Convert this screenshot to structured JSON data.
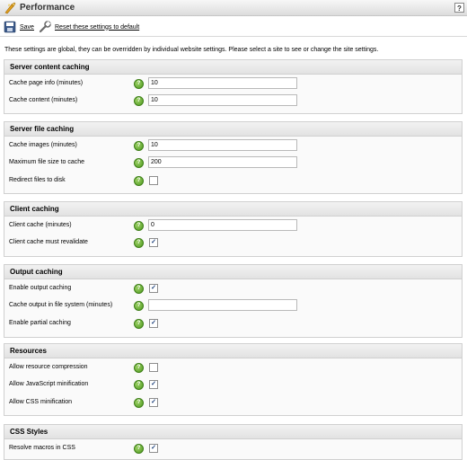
{
  "header": {
    "title": "Performance",
    "help_label": "?"
  },
  "toolbar": {
    "save_label": "Save",
    "reset_label": "Reset these settings to default"
  },
  "intro": "These settings are global, they can be overridden by individual website settings. Please select a site to see or change the site settings.",
  "hint_glyph": "?",
  "check_glyph": "✓",
  "sections": [
    {
      "title": "Server content caching",
      "rows": [
        {
          "label": "Cache page info (minutes)",
          "type": "text",
          "value": "10"
        },
        {
          "label": "Cache content (minutes)",
          "type": "text",
          "value": "10"
        }
      ]
    },
    {
      "title": "Server file caching",
      "rows": [
        {
          "label": "Cache images (minutes)",
          "type": "text",
          "value": "10"
        },
        {
          "label": "Maximum file size to cache",
          "type": "text",
          "value": "200"
        },
        {
          "label": "Redirect files to disk",
          "type": "checkbox",
          "checked": false
        }
      ]
    },
    {
      "title": "Client caching",
      "rows": [
        {
          "label": "Client cache (minutes)",
          "type": "text",
          "value": "0"
        },
        {
          "label": "Client cache must revalidate",
          "type": "checkbox",
          "checked": true
        }
      ]
    },
    {
      "title": "Output caching",
      "rows": [
        {
          "label": "Enable output caching",
          "type": "checkbox",
          "checked": true
        },
        {
          "label": "Cache output in file system (minutes)",
          "type": "text",
          "value": ""
        },
        {
          "label": "Enable partial caching",
          "type": "checkbox",
          "checked": true
        }
      ]
    },
    {
      "title": "Resources",
      "rows": [
        {
          "label": "Allow resource compression",
          "type": "checkbox",
          "checked": false
        },
        {
          "label": "Allow JavaScript minification",
          "type": "checkbox",
          "checked": true
        },
        {
          "label": "Allow CSS minification",
          "type": "checkbox",
          "checked": true
        }
      ]
    },
    {
      "title": "CSS Styles",
      "rows": [
        {
          "label": "Resolve macros in CSS",
          "type": "checkbox",
          "checked": true
        }
      ]
    }
  ]
}
